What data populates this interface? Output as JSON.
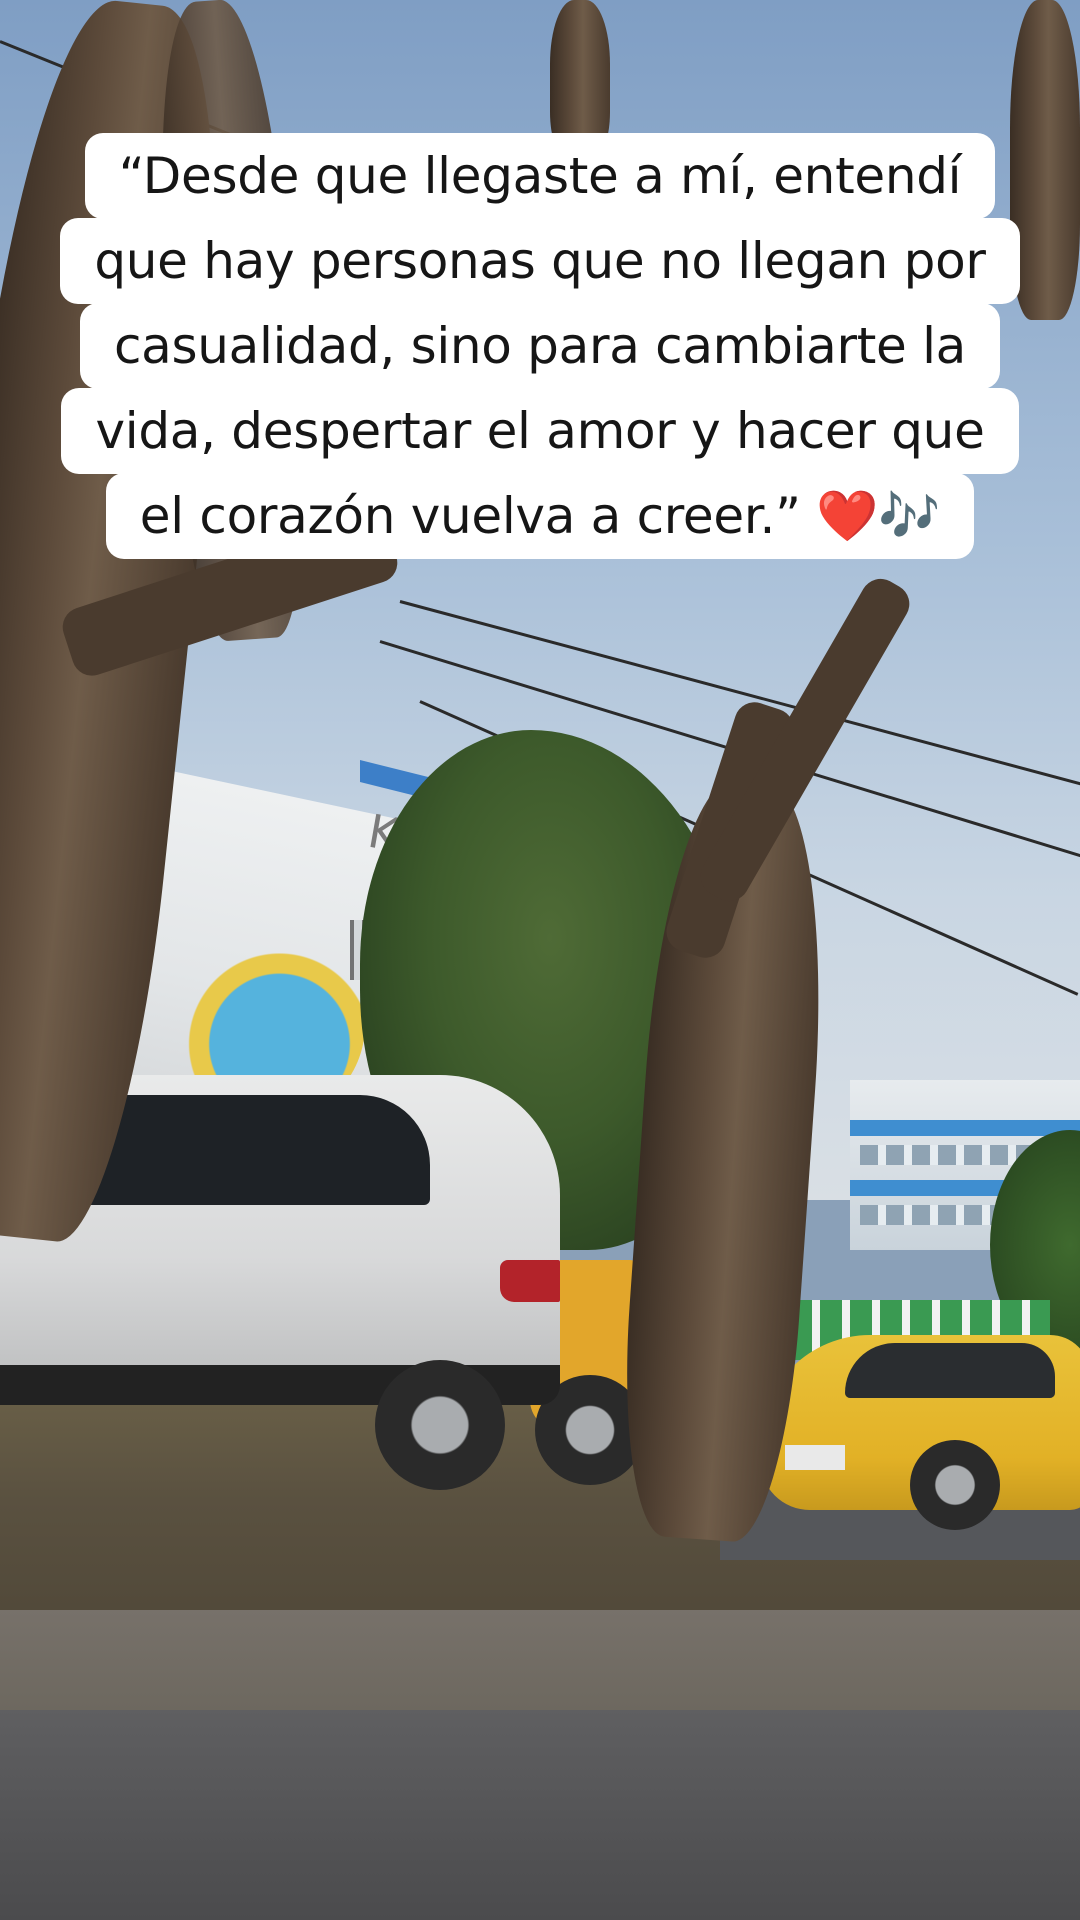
{
  "caption": {
    "lines": [
      "“Desde que llegaste a mí, entendí",
      "que hay personas que no llegan por",
      "casualidad, sino para cambiarte la",
      "vida, despertar el amor y hacer que",
      "el corazón vuelva a creer.”"
    ],
    "emoji_heart": "❤️",
    "emoji_notes": "🎶"
  },
  "scene": {
    "sign_text": "Kids"
  },
  "colors": {
    "caption_bg": "#ffffff",
    "caption_text": "#161616",
    "heart": "#e0112b",
    "notes": "#8b3bd6"
  }
}
